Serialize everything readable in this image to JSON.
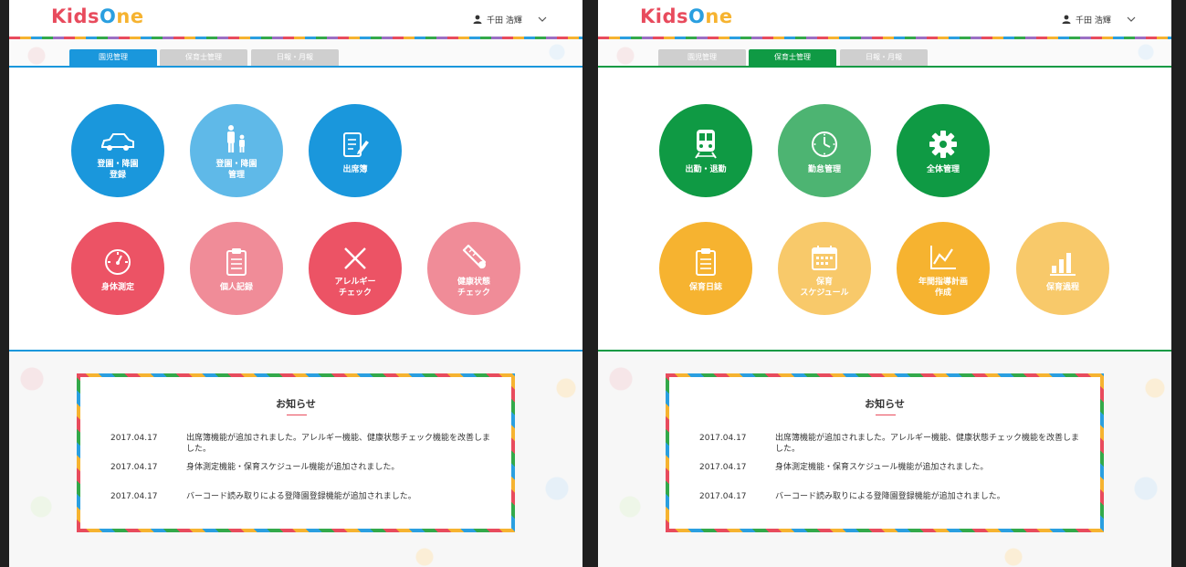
{
  "header": {
    "logo": {
      "kids": "Kids",
      "o": "O",
      "ne": "ne"
    },
    "user_name": "千田 浩輝"
  },
  "tabs": [
    {
      "label": "園児管理"
    },
    {
      "label": "保育士管理"
    },
    {
      "label": "日報・月報"
    }
  ],
  "left_screen": {
    "active_tab": 0,
    "buttons": [
      {
        "label": "登園・降園\n登録",
        "icon": "car-icon",
        "color": "#1a97dc"
      },
      {
        "label": "登園・降園\n管理",
        "icon": "parent-child-icon",
        "color": "#5fb9e8"
      },
      {
        "label": "出席簿",
        "icon": "notebook-pen-icon",
        "color": "#1a97dc"
      },
      {
        "label": "身体測定",
        "icon": "gauge-icon",
        "color": "#ec5365"
      },
      {
        "label": "個人記録",
        "icon": "clipboard-icon",
        "color": "#f08c98"
      },
      {
        "label": "アレルギー\nチェック",
        "icon": "cross-icon",
        "color": "#ec5365"
      },
      {
        "label": "健康状態\nチェック",
        "icon": "thermometer-icon",
        "color": "#f08c98"
      }
    ]
  },
  "right_screen": {
    "active_tab": 1,
    "buttons": [
      {
        "label": "出勤・退勤",
        "icon": "train-icon",
        "color": "#0f9a44"
      },
      {
        "label": "勤怠管理",
        "icon": "clock-icon",
        "color": "#4db472"
      },
      {
        "label": "全体管理",
        "icon": "gear-icon",
        "color": "#0f9a44"
      },
      {
        "label": "保育日誌",
        "icon": "clipboard-icon",
        "color": "#f6b330"
      },
      {
        "label": "保育\nスケジュール",
        "icon": "calendar-icon",
        "color": "#f8c96a"
      },
      {
        "label": "年間指導計画\n作成",
        "icon": "line-chart-icon",
        "color": "#f6b330"
      },
      {
        "label": "保育過程",
        "icon": "bar-chart-icon",
        "color": "#f8c96a"
      }
    ]
  },
  "news": {
    "title": "お知らせ",
    "items": [
      {
        "date": "2017.04.17",
        "text": "出席簿機能が追加されました。アレルギー機能、健康状態チェック機能を改善しました。"
      },
      {
        "date": "2017.04.17",
        "text": "身体測定機能・保育スケジュール機能が追加されました。"
      },
      {
        "date": "2017.04.17",
        "text": "バーコード読み取りによる登降園登録機能が追加されました。"
      }
    ]
  },
  "colors": {
    "blue": "#1a97dc",
    "green": "#0f9a44",
    "red": "#ec5365",
    "yellow": "#f6b330"
  }
}
